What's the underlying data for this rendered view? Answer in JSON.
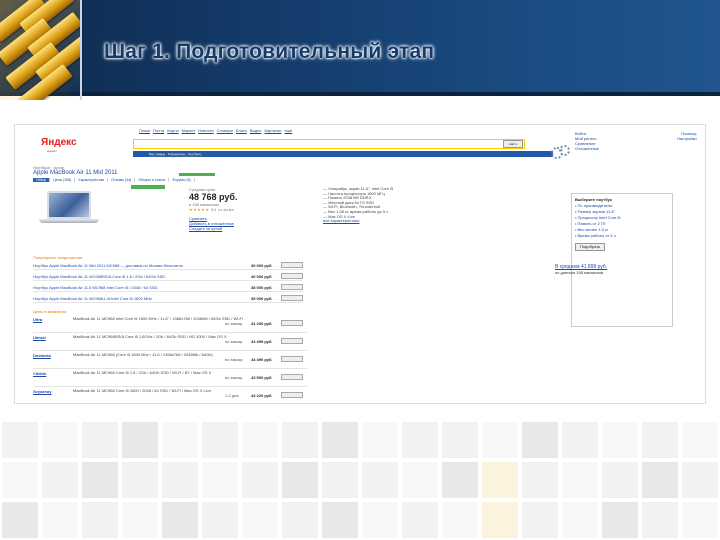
{
  "slide": {
    "title": "Шаг 1. Подготовительный этап",
    "colors": {
      "band": "#143c6c",
      "title": "#143a6b",
      "accent_gold": "#d89a12"
    }
  },
  "screenshot": {
    "logo": "Яндекс",
    "product_title": "Apple MacBook Air 11 Mid 2011",
    "price": "48 768 руб.",
    "search_button": "Найти",
    "offers_heading": "Популярные предложения",
    "offer_prices": [
      "40 000 руб.",
      "40 000 руб.",
      "38 000 руб.",
      "35 000 руб."
    ],
    "shop_prices": [
      "41 200 руб.",
      "44 499 руб.",
      "44 490 руб.",
      "43 500 руб.",
      "44 220 руб."
    ],
    "right_price_link": "В среднем 41 899 руб."
  }
}
